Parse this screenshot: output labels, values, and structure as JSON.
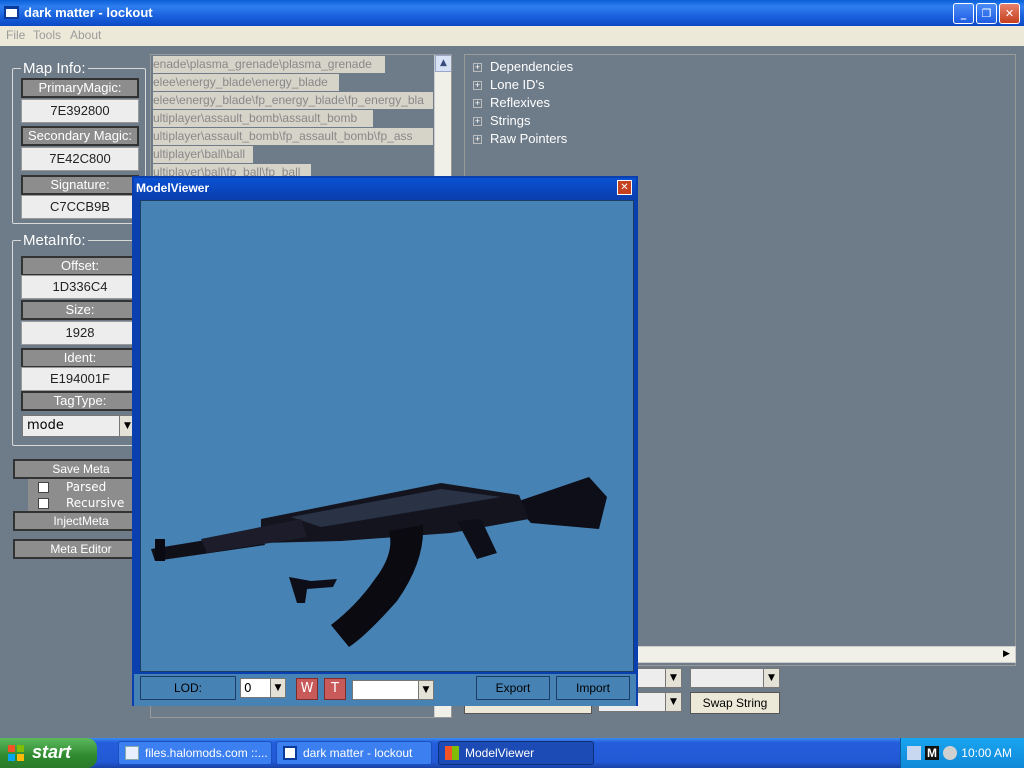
{
  "window": {
    "title": "dark matter - lockout"
  },
  "menubar": {
    "items": [
      "File",
      "Tools",
      "About"
    ]
  },
  "map_info": {
    "title": "Map Info:",
    "primary_magic_label": "PrimaryMagic:",
    "primary_magic_value": "7E392800",
    "secondary_magic_label": "Secondary Magic:",
    "secondary_magic_value": "7E42C800",
    "signature_label": "Signature:",
    "signature_value": "C7CCB9B"
  },
  "meta_info": {
    "title": "MetaInfo:",
    "offset_label": "Offset:",
    "offset_value": "1D336C4",
    "size_label": "Size:",
    "size_value": "1928",
    "ident_label": "Ident:",
    "ident_value": "E194001F",
    "tagtype_label": "TagType:",
    "tagtype_value": "mode"
  },
  "actions": {
    "save_meta": "Save Meta",
    "parsed": "Parsed",
    "recursive": "Recursive",
    "inject_meta": "InjectMeta",
    "meta_editor": "Meta Editor"
  },
  "tag_list": {
    "items": [
      "enade\\plasma_grenade\\plasma_grenade",
      "elee\\energy_blade\\energy_blade",
      "elee\\energy_blade\\fp_energy_blade\\fp_energy_bla",
      "ultiplayer\\assault_bomb\\assault_bomb",
      "ultiplayer\\assault_bomb\\fp_assault_bomb\\fp_ass",
      "ultiplayer\\ball\\ball",
      "ultiplayer\\ball\\fp_ball\\fp_ball"
    ]
  },
  "tree": {
    "items": [
      "Dependencies",
      "Lone ID's",
      "Reflexives",
      "Strings",
      "Raw Pointers"
    ]
  },
  "bottom": {
    "swap_string": "Swap String"
  },
  "modelviewer": {
    "title": "ModelViewer",
    "lod_label": "LOD:",
    "lod_value": "0",
    "w_button": "W",
    "t_button": "T",
    "export_button": "Export",
    "import_button": "Import"
  },
  "taskbar": {
    "start": "start",
    "tasks": [
      "files.halomods.com ::...",
      "dark matter - lockout",
      "ModelViewer"
    ],
    "clock": "10:00 AM"
  },
  "colors": {
    "client_bg": "#6e7b88",
    "viewport_bg": "#4682b4",
    "titlebar": "#0a52d4"
  }
}
